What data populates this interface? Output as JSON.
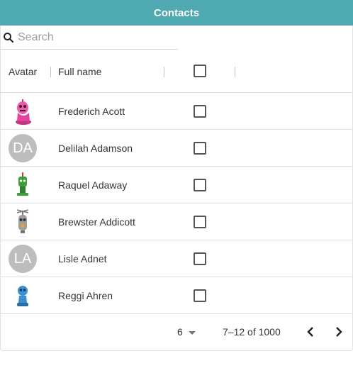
{
  "app": {
    "title": "Contacts"
  },
  "search": {
    "placeholder": "Search",
    "value": ""
  },
  "columns": {
    "avatar": "Avatar",
    "full_name": "Full name"
  },
  "rows": [
    {
      "name": "Frederich Acott",
      "avatar": {
        "kind": "robot",
        "icon": "pink-robot-icon",
        "color": "#e0449a"
      }
    },
    {
      "name": "Delilah Adamson",
      "avatar": {
        "kind": "initials",
        "initials": "DA",
        "color": "#bdbdbd"
      }
    },
    {
      "name": "Raquel Adaway",
      "avatar": {
        "kind": "robot",
        "icon": "green-robot-icon",
        "color": "#3b9e3b"
      }
    },
    {
      "name": "Brewster Addicott",
      "avatar": {
        "kind": "robot",
        "icon": "gray-robot-icon",
        "color": "#9e9e9e"
      }
    },
    {
      "name": "Lisle Adnet",
      "avatar": {
        "kind": "initials",
        "initials": "LA",
        "color": "#bdbdbd"
      }
    },
    {
      "name": "Reggi Ahren",
      "avatar": {
        "kind": "robot",
        "icon": "blue-robot-icon",
        "color": "#3a8fd0"
      }
    }
  ],
  "pagination": {
    "page_size": "6",
    "range_label": "7–12 of 1000"
  },
  "colors": {
    "accent": "#4eaab0"
  }
}
